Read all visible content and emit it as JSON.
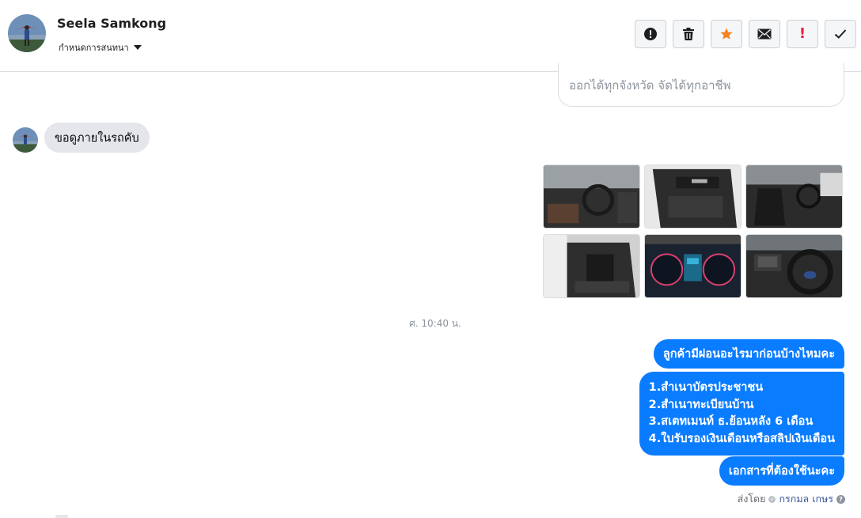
{
  "header": {
    "contact_name": "Seela Samkong",
    "assign_label": "กำหนดการสนทนา",
    "actions": [
      {
        "name": "report-spam-button",
        "icon": "alert-circle-icon"
      },
      {
        "name": "delete-button",
        "icon": "trash-icon"
      },
      {
        "name": "star-button",
        "icon": "star-icon"
      },
      {
        "name": "mark-unread-button",
        "icon": "envelope-icon"
      },
      {
        "name": "follow-up-button",
        "icon": "exclamation-icon"
      },
      {
        "name": "done-button",
        "icon": "check-icon"
      }
    ]
  },
  "messages": {
    "previous_card_text": "ออกได้ทุกจังหวัด จัดได้ทุกอาชีพ",
    "incoming_text": "ขอดูภายในรถคับ",
    "photos": [
      {
        "icon": "dashboard-photo"
      },
      {
        "icon": "door-panel-photo"
      },
      {
        "icon": "front-seats-photo"
      },
      {
        "icon": "rear-cab-photo"
      },
      {
        "icon": "instrument-cluster-photo"
      },
      {
        "icon": "steering-wheel-photo"
      }
    ],
    "timestamp": "ศ. 10:40 น.",
    "outgoing_1": "ลูกค้ามีผ่อนอะไรมาก่อนบ้างไหมคะ",
    "outgoing_2_lines": [
      "1.สำเนาบัตรประชาชน",
      "2.สำเนาทะเบียนบ้าน",
      "3.สเตทเมนท์ ธ.ย้อนหลัง 6 เดือน",
      "4.ใบรับรองเงินเดือนหรือสลิปเงินเดือน"
    ],
    "outgoing_3": "เอกสารที่ต้องใช้นะคะ",
    "sent_by_label": "ส่งโดย",
    "sent_by_agent": "กรกมล เกษร"
  },
  "colors": {
    "accent": "#0a7cff",
    "star": "#f5821f",
    "alert": "#e41e3f",
    "incoming_bubble": "#e4e6eb"
  }
}
